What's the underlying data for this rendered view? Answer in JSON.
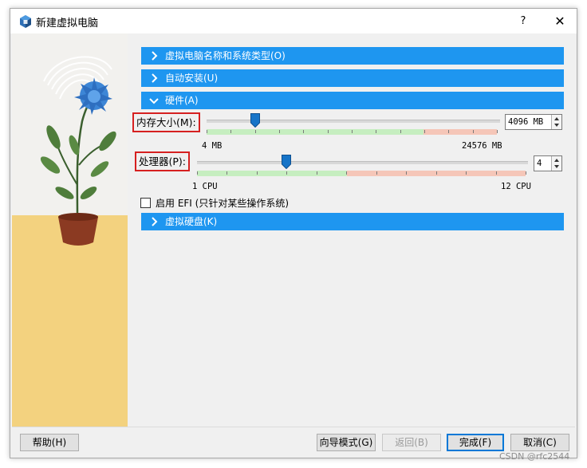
{
  "window": {
    "title": "新建虚拟电脑",
    "help_label": "?",
    "close_label": "✕"
  },
  "sections": [
    {
      "label": "虚拟电脑名称和系统类型(O)",
      "expanded": false
    },
    {
      "label": "自动安装(U)",
      "expanded": false
    },
    {
      "label": "硬件(A)",
      "expanded": true
    },
    {
      "label": "虚拟硬盘(K)",
      "expanded": false
    }
  ],
  "hardware": {
    "memory": {
      "label": "内存大小(M):",
      "value": "4096 MB",
      "min_label": "4 MB",
      "max_label": "24576 MB",
      "min": 4,
      "max": 24576,
      "current": 4096
    },
    "processor": {
      "label": "处理器(P):",
      "value": "4",
      "min_label": "1 CPU",
      "max_label": "12 CPU",
      "min": 1,
      "max": 12,
      "current": 4
    },
    "efi_label": "启用 EFI (只针对某些操作系统)",
    "efi_checked": false
  },
  "buttons": {
    "help": "帮助(H)",
    "guided_mode": "向导模式(G)",
    "back": "返回(B)",
    "finish": "完成(F)",
    "cancel": "取消(C)"
  },
  "watermark": "CSDN @rfc2544",
  "colors": {
    "section_header": "#1e96f0",
    "highlight_box": "#d62020",
    "thumb": "#1674c8",
    "zone_green": "#c6eec0",
    "zone_red": "#f5c6b8"
  }
}
